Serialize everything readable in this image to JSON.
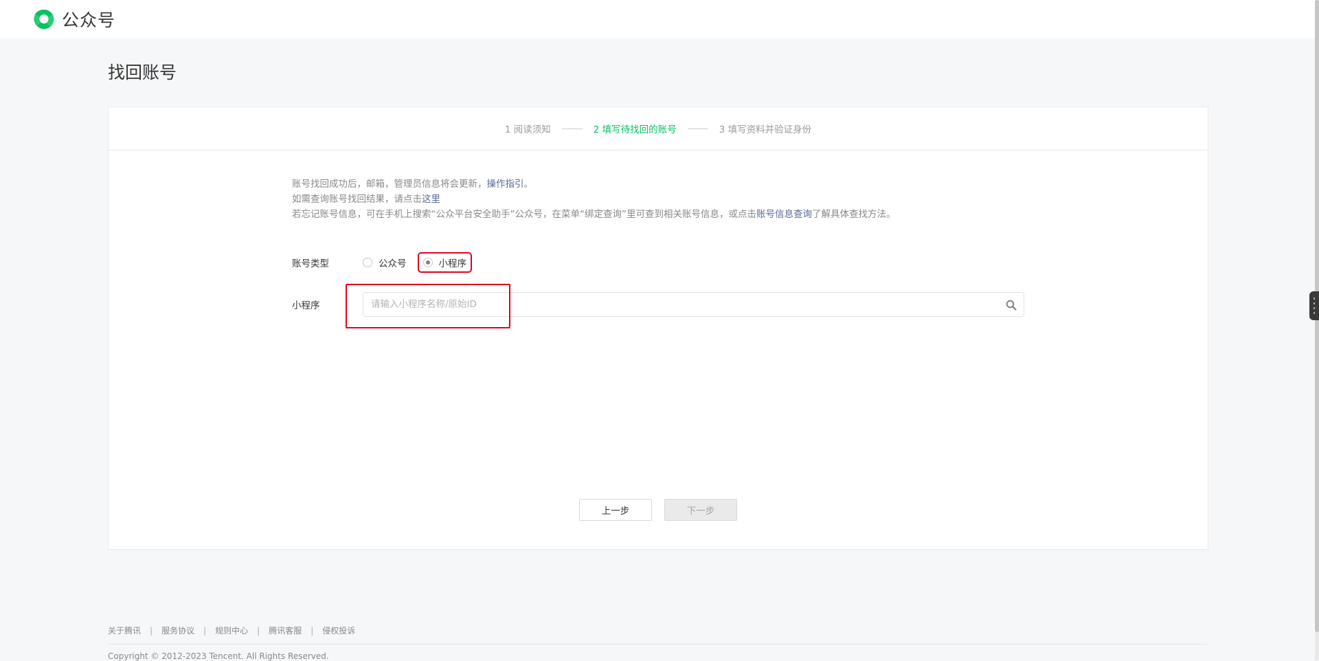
{
  "header": {
    "brand_name": "公众号",
    "brand_color": "#07c160"
  },
  "page": {
    "title": "找回账号"
  },
  "steps": [
    {
      "label": "1 阅读须知",
      "active": false
    },
    {
      "label": "2 填写待找回的账号",
      "active": true
    },
    {
      "label": "3 填写资料并验证身份",
      "active": false
    }
  ],
  "notice": {
    "line1_text": "账号找回成功后，邮箱，管理员信息将会更新，",
    "line1_link": "操作指引",
    "line1_end": "。",
    "line2_text": "如需查询账号找回结果，请点击",
    "line2_link": "这里",
    "line3_text": "若忘记账号信息，可在手机上搜索“公众平台安全助手”公众号，在菜单“绑定查询”里可查到相关账号信息，或点击",
    "line3_link": "账号信息查询",
    "line3_end": "了解具体查找方法。",
    "link_color": "#576b95"
  },
  "form": {
    "account_type_label": "账号类型",
    "options": [
      {
        "label": "公众号",
        "checked": false
      },
      {
        "label": "小程序",
        "checked": true
      }
    ],
    "mini_label": "小程序",
    "search_value": "",
    "search_placeholder": "请输入小程序名称/原始ID",
    "search_icon": "search-icon"
  },
  "actions": {
    "prev_label": "上一步",
    "next_label": "下一步",
    "next_disabled": true
  },
  "footer": {
    "links": [
      "关于腾讯",
      "服务协议",
      "规则中心",
      "腾讯客服",
      "侵权投诉"
    ],
    "separator": "|",
    "copyright": "Copyright © 2012-2023 Tencent. All Rights Reserved."
  },
  "annotation_color": "#e0001b"
}
